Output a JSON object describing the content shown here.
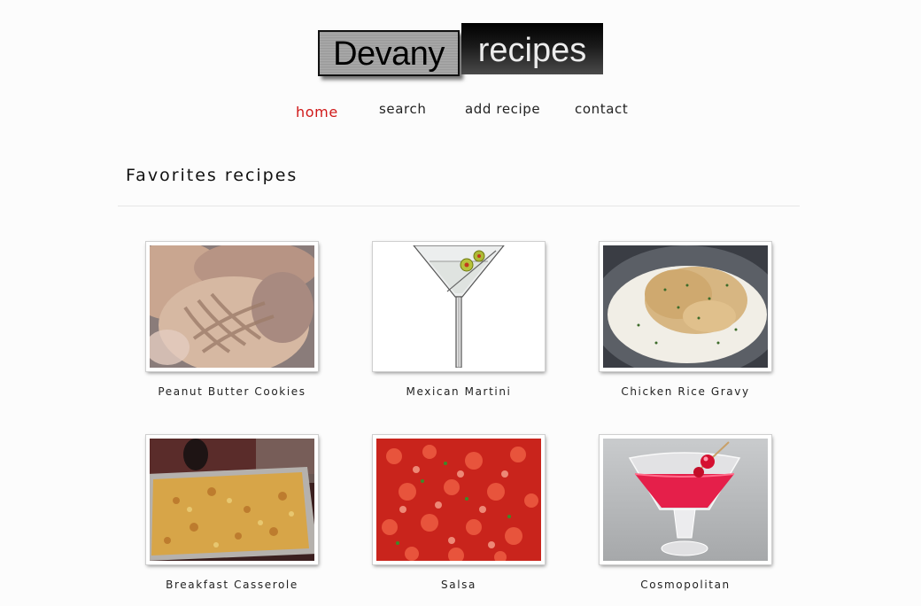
{
  "logo": {
    "part1": "Devany",
    "part2": "recipes"
  },
  "nav": [
    {
      "label": "home",
      "active": true
    },
    {
      "label": "search",
      "active": false
    },
    {
      "label": "add recipe",
      "active": false
    },
    {
      "label": "contact",
      "active": false
    }
  ],
  "section": {
    "title": "Favorites recipes"
  },
  "recipes": [
    {
      "title": "Peanut Butter Cookies"
    },
    {
      "title": "Mexican Martini"
    },
    {
      "title": "Chicken Rice Gravy"
    },
    {
      "title": "Breakfast Casserole"
    },
    {
      "title": "Salsa"
    },
    {
      "title": "Cosmopolitan"
    }
  ],
  "colors": {
    "active_nav": "#d01818",
    "text": "#222222",
    "background": "#fcfcfc"
  }
}
